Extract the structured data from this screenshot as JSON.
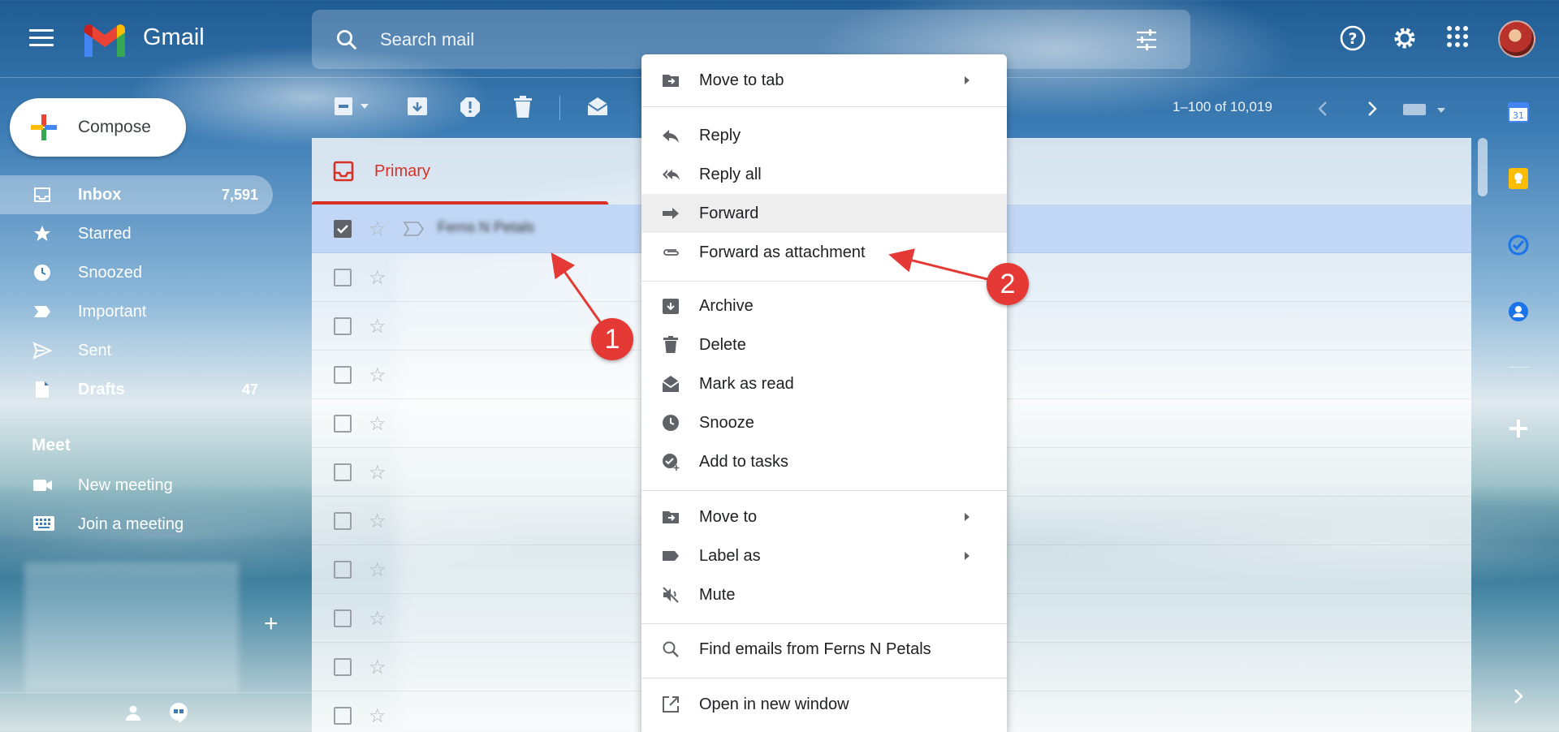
{
  "app": {
    "logo_text": "Gmail"
  },
  "search": {
    "placeholder": "Search mail"
  },
  "compose": {
    "label": "Compose"
  },
  "sidebar": {
    "items": [
      {
        "label": "Inbox",
        "count": "7,591",
        "icon": "inbox-icon",
        "active": true,
        "bold": true
      },
      {
        "label": "Starred",
        "count": "",
        "icon": "star-icon"
      },
      {
        "label": "Snoozed",
        "count": "",
        "icon": "clock-icon"
      },
      {
        "label": "Important",
        "count": "",
        "icon": "important-icon"
      },
      {
        "label": "Sent",
        "count": "",
        "icon": "send-icon"
      },
      {
        "label": "Drafts",
        "count": "47",
        "icon": "draft-icon",
        "bold": true
      }
    ]
  },
  "meet": {
    "title": "Meet",
    "new_meeting": "New meeting",
    "join_meeting": "Join a meeting"
  },
  "pagination": {
    "range": "1–100 of 10,019"
  },
  "tabs": {
    "primary": "Primary"
  },
  "list": {
    "selected_sender": "Ferns N Petals",
    "row_count": 11
  },
  "context_menu": {
    "items": [
      {
        "label": "Move to tab",
        "icon": "move-to-tab-icon",
        "submenu": true
      },
      {
        "label": "Reply",
        "icon": "reply-icon"
      },
      {
        "label": "Reply all",
        "icon": "reply-all-icon"
      },
      {
        "label": "Forward",
        "icon": "forward-icon",
        "hover": true
      },
      {
        "label": "Forward as attachment",
        "icon": "attachment-icon"
      },
      {
        "label": "Archive",
        "icon": "archive-icon"
      },
      {
        "label": "Delete",
        "icon": "trash-icon"
      },
      {
        "label": "Mark as read",
        "icon": "mark-read-icon"
      },
      {
        "label": "Snooze",
        "icon": "clock-icon"
      },
      {
        "label": "Add to tasks",
        "icon": "add-task-icon"
      },
      {
        "label": "Move to",
        "icon": "move-to-icon",
        "submenu": true
      },
      {
        "label": "Label as",
        "icon": "label-icon",
        "submenu": true
      },
      {
        "label": "Mute",
        "icon": "mute-icon"
      },
      {
        "label": "Find emails from Ferns N Petals",
        "icon": "search-icon"
      },
      {
        "label": "Open in new window",
        "icon": "open-new-window-icon"
      }
    ]
  },
  "callouts": {
    "one": "1",
    "two": "2"
  },
  "colors": {
    "accent_red": "#d93025",
    "callout_red": "#e53935",
    "selected_row": "#c2d7f5"
  }
}
